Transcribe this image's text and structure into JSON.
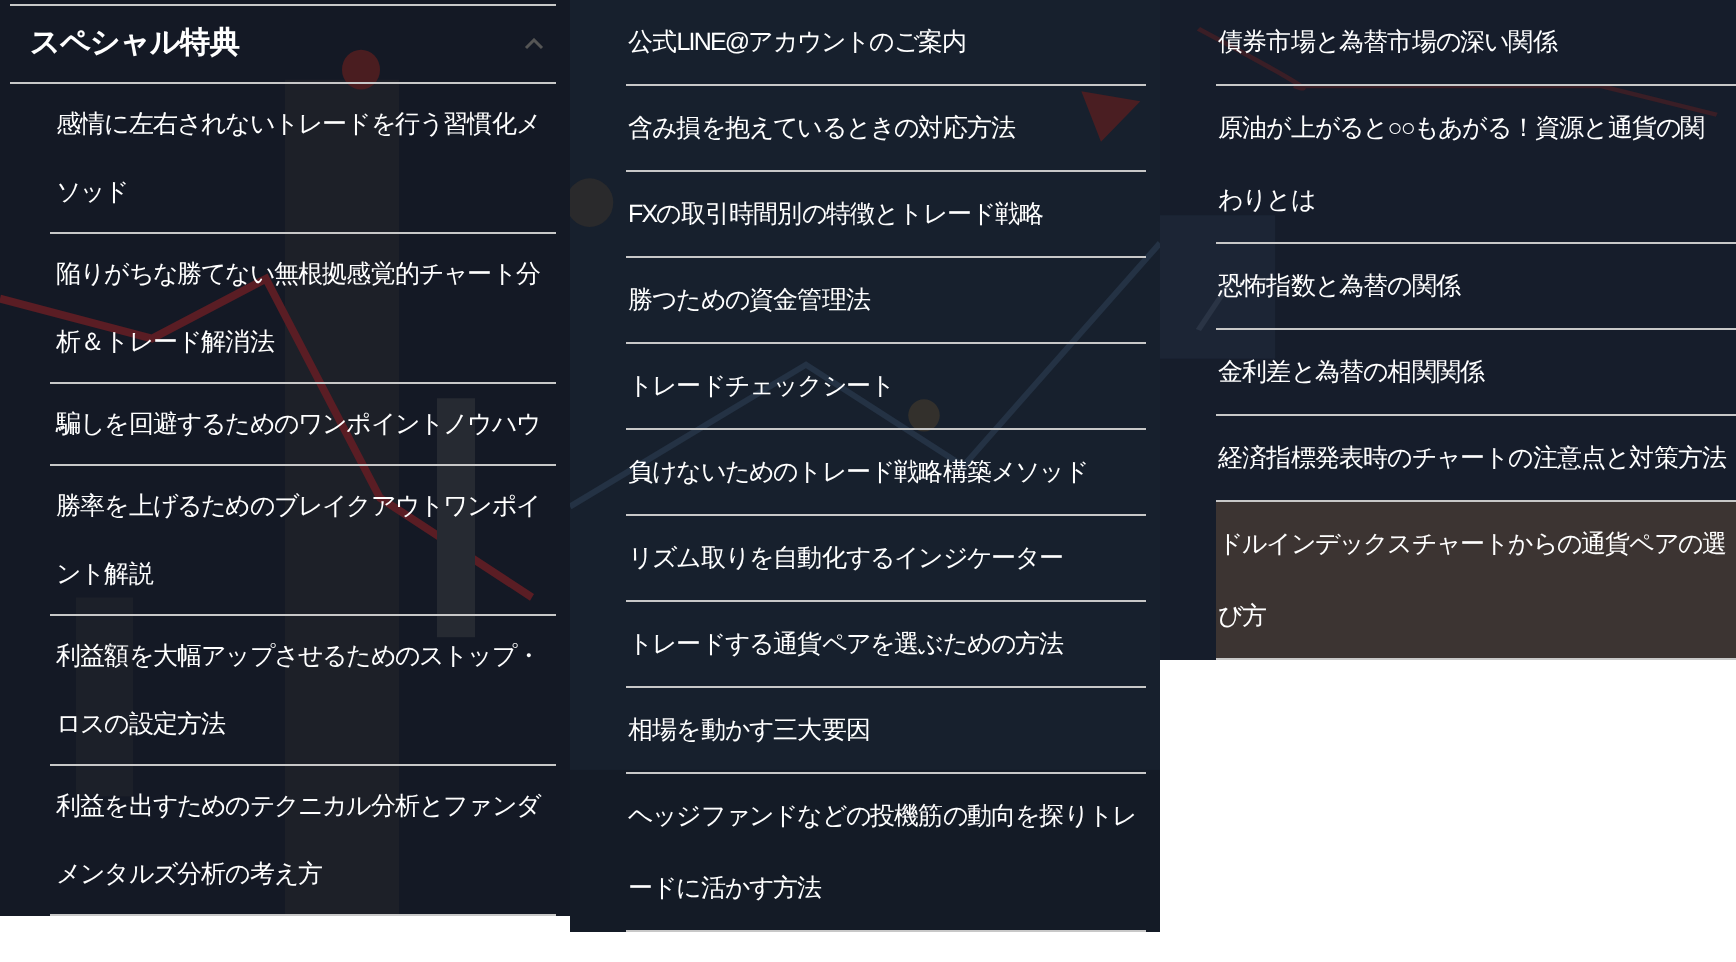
{
  "columns": [
    {
      "header": {
        "title": "スペシャル特典",
        "expanded": true
      },
      "items": [
        {
          "label": "感情に左右されないトレードを行う習慣化メソッド",
          "selected": false
        },
        {
          "label": "陥りがちな勝てない無根拠感覚的チャート分析＆トレード解消法",
          "selected": false
        },
        {
          "label": "騙しを回避するためのワンポイントノウハウ",
          "selected": false
        },
        {
          "label": "勝率を上げるためのブレイクアウトワンポイント解説",
          "selected": false
        },
        {
          "label": "利益額を大幅アップさせるためのストップ・ロスの設定方法",
          "selected": false
        },
        {
          "label": "利益を出すためのテクニカル分析とファンダメンタルズ分析の考え方",
          "selected": false
        }
      ]
    },
    {
      "items": [
        {
          "label": "公式LINE@アカウントのご案内",
          "selected": false
        },
        {
          "label": "含み損を抱えているときの対応方法",
          "selected": false
        },
        {
          "label": "FXの取引時間別の特徴とトレード戦略",
          "selected": false
        },
        {
          "label": "勝つための資金管理法",
          "selected": false
        },
        {
          "label": "トレードチェックシート",
          "selected": false
        },
        {
          "label": "負けないためのトレード戦略構築メソッド",
          "selected": false
        },
        {
          "label": "リズム取りを自動化するインジケーター",
          "selected": false
        },
        {
          "label": "トレードする通貨ペアを選ぶための方法",
          "selected": false
        },
        {
          "label": "相場を動かす三大要因",
          "selected": false
        },
        {
          "label": "ヘッジファンドなどの投機筋の動向を探りトレードに活かす方法",
          "selected": false
        }
      ]
    },
    {
      "items": [
        {
          "label": "債券市場と為替市場の深い関係",
          "selected": false
        },
        {
          "label": "原油が上がると○○もあがる！資源と通貨の関わりとは",
          "selected": false
        },
        {
          "label": "恐怖指数と為替の関係",
          "selected": false
        },
        {
          "label": "金利差と為替の相関関係",
          "selected": false
        },
        {
          "label": "経済指標発表時のチャートの注意点と対策方法",
          "selected": false
        },
        {
          "label": "ドルインデックスチャートからの通貨ペアの選び方",
          "selected": true
        }
      ]
    }
  ]
}
